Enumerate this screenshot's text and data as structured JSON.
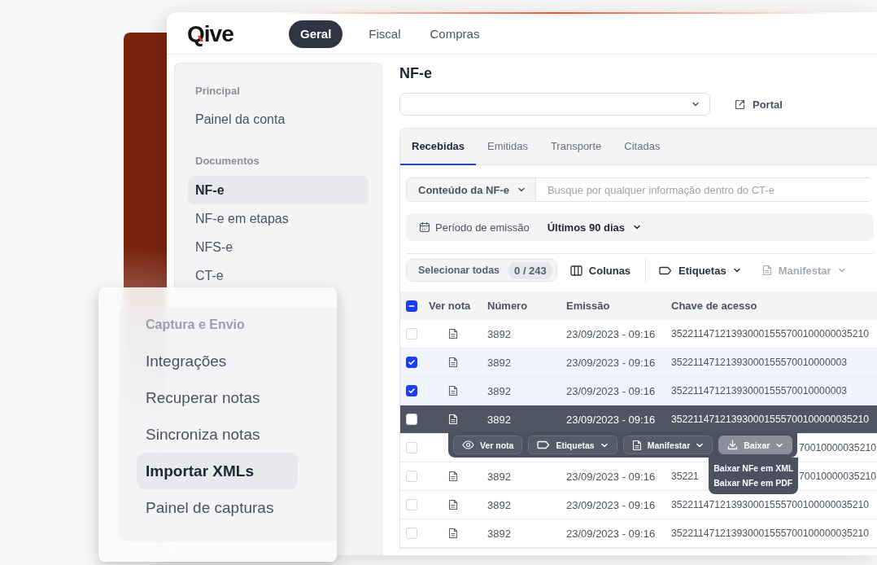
{
  "logo": "Qive",
  "nav_tabs": [
    {
      "label": "Geral",
      "selected": true
    },
    {
      "label": "Fiscal",
      "selected": false
    },
    {
      "label": "Compras",
      "selected": false
    }
  ],
  "sidebar": {
    "sections": [
      {
        "title": "Principal",
        "items": [
          {
            "label": "Painel da conta",
            "selected": false
          }
        ]
      },
      {
        "title": "Documentos",
        "items": [
          {
            "label": "NF-e",
            "selected": true
          },
          {
            "label": "NF-e em etapas",
            "selected": false
          },
          {
            "label": "NFS-e",
            "selected": false
          },
          {
            "label": "CT-e",
            "selected": false
          }
        ]
      }
    ]
  },
  "page": {
    "title": "NF-e",
    "portal_link": "Portal"
  },
  "doc_tabs": [
    {
      "label": "Recebidas",
      "selected": true
    },
    {
      "label": "Emitidas",
      "selected": false
    },
    {
      "label": "Transporte",
      "selected": false
    },
    {
      "label": "Citadas",
      "selected": false
    }
  ],
  "search": {
    "scope": "Conteúdo da NF-e",
    "placeholder": "Busque por qualquer informação dentro do CT-e"
  },
  "period": {
    "label": "Período de emissão",
    "value": "Últimos 90 dias"
  },
  "toolbar": {
    "select_all": "Selecionar todas",
    "count": "0 / 243",
    "items": [
      {
        "kind": "columns",
        "label": "Colunas",
        "disabled": false,
        "caret": false
      },
      {
        "kind": "tags",
        "label": "Etiquetas",
        "disabled": false,
        "caret": true
      },
      {
        "kind": "manifest",
        "label": "Manifestar",
        "disabled": true,
        "caret": true
      }
    ]
  },
  "table": {
    "select_all": {
      "indeterminate": true
    },
    "columns": [
      "Ver nota",
      "Número",
      "Emissão",
      "Chave de acesso"
    ],
    "rows": [
      {
        "checked": false,
        "hovered": false,
        "number": "3892",
        "emission": "23/09/2023 - 09:16",
        "key": "352211471213930001555700100000035210"
      },
      {
        "checked": true,
        "hovered": false,
        "number": "3892",
        "emission": "23/09/2023 - 09:16",
        "key": "35221147121393000155570010000003"
      },
      {
        "checked": true,
        "hovered": false,
        "number": "3892",
        "emission": "23/09/2023 - 09:16",
        "key": "35221147121393000155570010000003"
      },
      {
        "checked": false,
        "hovered": true,
        "number": "3892",
        "emission": "23/09/2023 - 09:16",
        "key": "352211471213930001555700100000035210"
      },
      {
        "checked": false,
        "hovered": false,
        "key_end": "70010000035210"
      },
      {
        "checked": false,
        "hovered": false,
        "number": "3892",
        "emission": "23/09/2023 - 09:16",
        "key_start": "35221",
        "key_end": "70010000035210"
      },
      {
        "checked": false,
        "hovered": false,
        "number": "3892",
        "emission": "23/09/2023 - 09:16",
        "key": "352211471213930001555700100000035210"
      },
      {
        "checked": false,
        "hovered": false,
        "number": "3892",
        "emission": "23/09/2023 - 09:16",
        "key": "352211471213930001555700100000035210"
      }
    ]
  },
  "row_actions": {
    "buttons": [
      {
        "kind": "view",
        "label": "Ver nota",
        "open": false,
        "caret": false
      },
      {
        "kind": "tags",
        "label": "Etiquetas",
        "open": false,
        "caret": true
      },
      {
        "kind": "manifest",
        "label": "Manifestar",
        "open": false,
        "caret": true
      },
      {
        "kind": "download",
        "label": "Baixar",
        "open": true,
        "caret": true
      }
    ],
    "menu": [
      "Baixar NFe em XML",
      "Baixar NFe em PDF"
    ]
  },
  "capture_menu": {
    "title": "Captura e Envio",
    "items": [
      {
        "label": "Integrações",
        "selected": false
      },
      {
        "label": "Recuperar notas",
        "selected": false
      },
      {
        "label": "Sincroniza notas",
        "selected": false
      },
      {
        "label": "Importar XMLs",
        "selected": true
      },
      {
        "label": "Painel de capturas",
        "selected": false
      }
    ]
  }
}
